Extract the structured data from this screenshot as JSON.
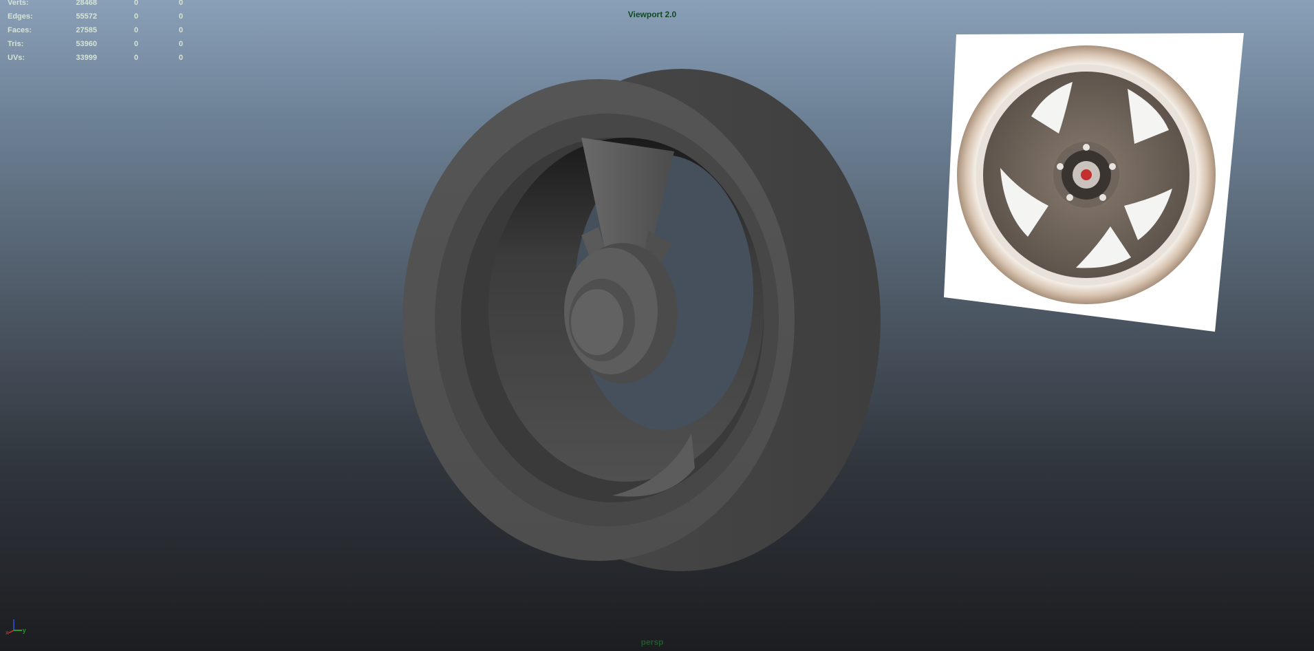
{
  "viewport": {
    "renderer_label": "Viewport 2.0",
    "camera_label": "persp"
  },
  "heads_up_display": {
    "rows": [
      {
        "label": "Verts:",
        "v1": "28468",
        "v2": "0",
        "v3": "0"
      },
      {
        "label": "Edges:",
        "v1": "55572",
        "v2": "0",
        "v3": "0"
      },
      {
        "label": "Faces:",
        "v1": "27585",
        "v2": "0",
        "v3": "0"
      },
      {
        "label": "Tris:",
        "v1": "53960",
        "v2": "0",
        "v3": "0"
      },
      {
        "label": "UVs:",
        "v1": "33999",
        "v2": "0",
        "v3": "0"
      }
    ]
  },
  "axis_gizmo": {
    "x_label": "x",
    "y_label": "y",
    "colors": {
      "x": "#e03030",
      "y": "#30c030",
      "z": "#3050e0"
    }
  },
  "colors": {
    "hud_text": "#d6e4d6",
    "label_green": "#0f4a21",
    "model_gray": "#555555"
  }
}
